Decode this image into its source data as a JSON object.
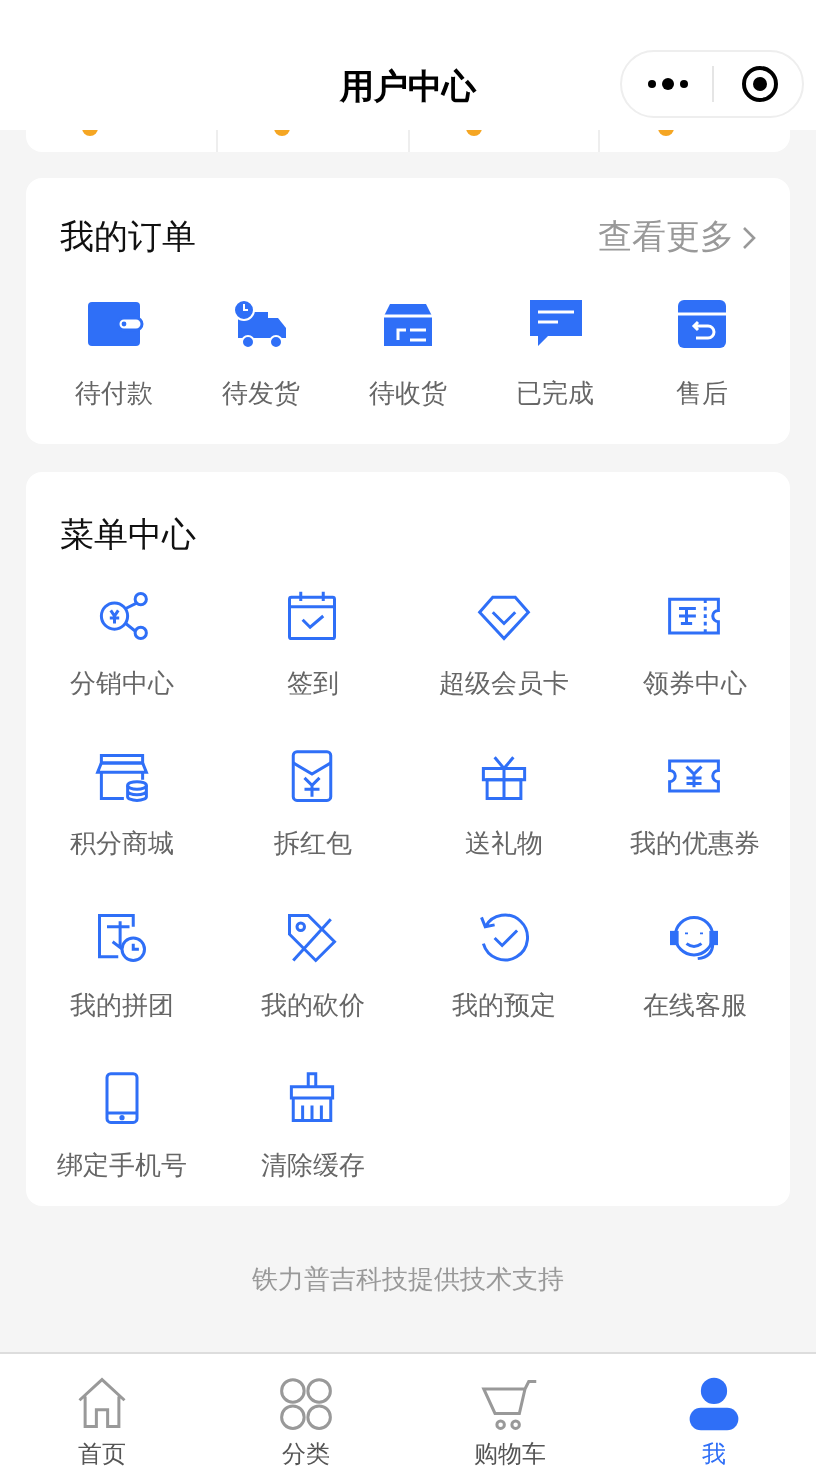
{
  "nav_bar": {
    "title": "用户中心"
  },
  "stats_strip": {
    "items": [
      {
        "kind": "stat"
      },
      {
        "kind": "stat"
      },
      {
        "kind": "stat"
      },
      {
        "kind": "stat"
      }
    ]
  },
  "orders": {
    "title": "我的订单",
    "more_link": "查看更多",
    "items": [
      {
        "label": "待付款"
      },
      {
        "label": "待发货"
      },
      {
        "label": "待收货"
      },
      {
        "label": "已完成"
      },
      {
        "label": "售后"
      }
    ]
  },
  "menu": {
    "title": "菜单中心",
    "items": [
      {
        "label": "分销中心"
      },
      {
        "label": "签到"
      },
      {
        "label": "超级会员卡"
      },
      {
        "label": "领券中心"
      },
      {
        "label": "积分商城"
      },
      {
        "label": "拆红包"
      },
      {
        "label": "送礼物"
      },
      {
        "label": "我的优惠券"
      },
      {
        "label": "我的拼团"
      },
      {
        "label": "我的砍价"
      },
      {
        "label": "我的预定"
      },
      {
        "label": "在线客服"
      },
      {
        "label": "绑定手机号"
      },
      {
        "label": "清除缓存"
      }
    ]
  },
  "footer": "铁力普吉科技提供技术支持",
  "tab_bar": [
    {
      "label": "首页",
      "selected": false
    },
    {
      "label": "分类",
      "selected": false
    },
    {
      "label": "购物车",
      "selected": false
    },
    {
      "label": "我",
      "selected": true
    }
  ]
}
